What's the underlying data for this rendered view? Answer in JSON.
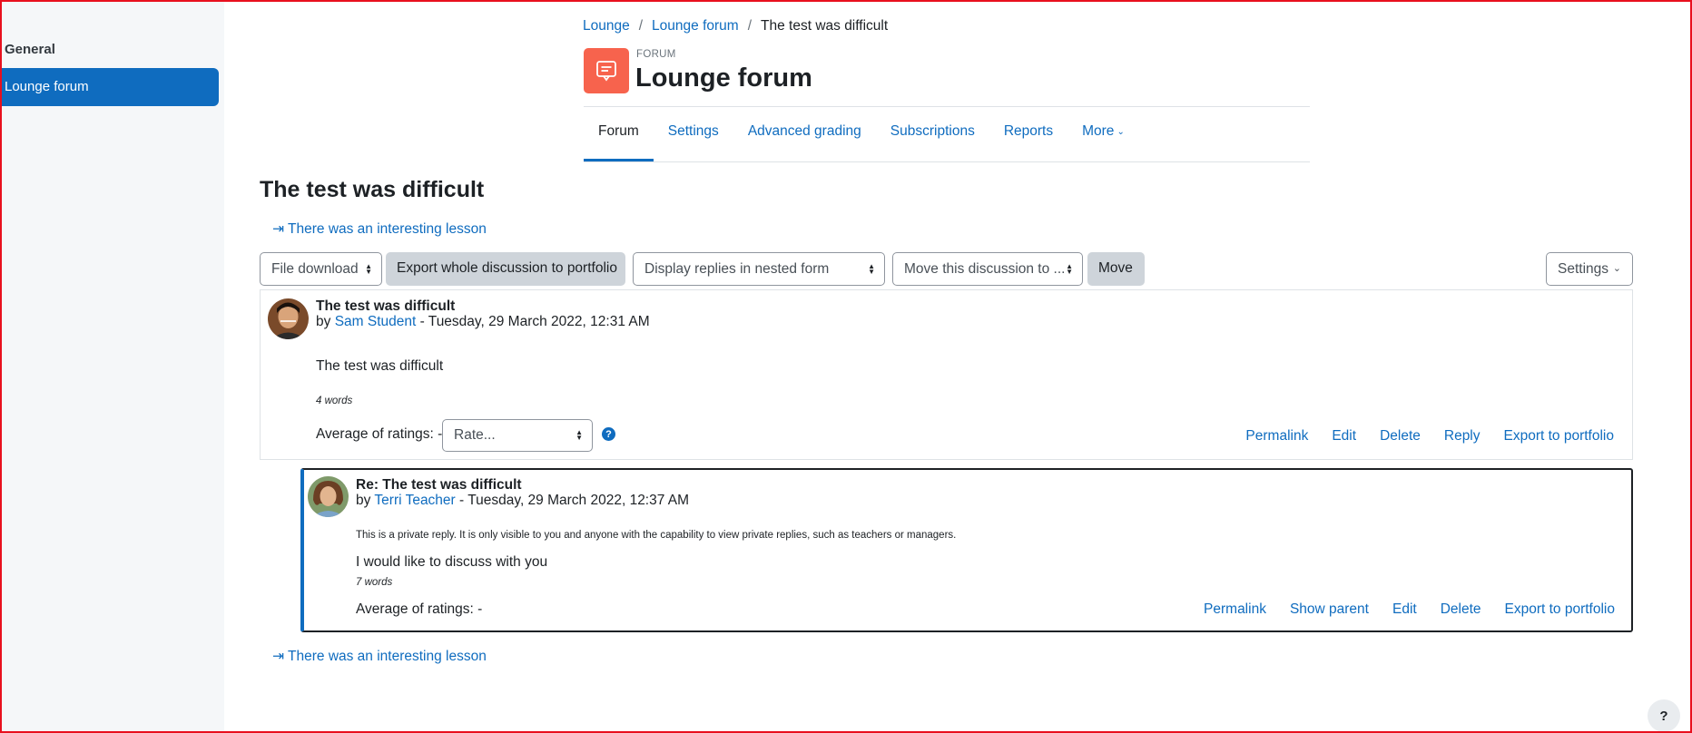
{
  "sidebar": {
    "section_title": "General",
    "active_item": "Lounge forum"
  },
  "breadcrumb": [
    "Lounge",
    "Lounge forum",
    "The test was difficult"
  ],
  "forum": {
    "kicker": "FORUM",
    "title": "Lounge forum"
  },
  "tabs": [
    {
      "label": "Forum",
      "active": true
    },
    {
      "label": "Settings"
    },
    {
      "label": "Advanced grading"
    },
    {
      "label": "Subscriptions"
    },
    {
      "label": "Reports"
    },
    {
      "label": "More"
    }
  ],
  "discussion": {
    "title": "The test was difficult",
    "prev_link": "There was an interesting lesson",
    "next_link": "There was an interesting lesson"
  },
  "toolbar": {
    "file_download": "File download",
    "export_button": "Export whole discussion to portfolio",
    "display_mode": "Display replies in nested form",
    "move_select": "Move this discussion to ...",
    "move_button": "Move",
    "settings_button": "Settings"
  },
  "posts": [
    {
      "subject": "The test was difficult",
      "by_prefix": "by",
      "author": "Sam Student",
      "date": "- Tuesday, 29 March 2022, 12:31 AM",
      "body": "The test was difficult",
      "words": "4 words",
      "rating_label": "Average of ratings: -",
      "rate_placeholder": "Rate...",
      "actions": [
        "Permalink",
        "Edit",
        "Delete",
        "Reply",
        "Export to portfolio"
      ]
    },
    {
      "subject": "Re: The test was difficult",
      "by_prefix": "by",
      "author": "Terri Teacher",
      "date": "- Tuesday, 29 March 2022, 12:37 AM",
      "private_note": "This is a private reply. It is only visible to you and anyone with the capability to view private replies, such as teachers or managers.",
      "body": "I would like to discuss with you",
      "words": "7 words",
      "rating_label": "Average of ratings: -",
      "actions": [
        "Permalink",
        "Show parent",
        "Edit",
        "Delete",
        "Export to portfolio"
      ]
    }
  ],
  "help_button": "?",
  "colors": {
    "accent": "#0f6cbf",
    "forum_icon_bg": "#f7634d",
    "sidebar_bg": "#f5f7f9",
    "frame": "#e8101e"
  }
}
